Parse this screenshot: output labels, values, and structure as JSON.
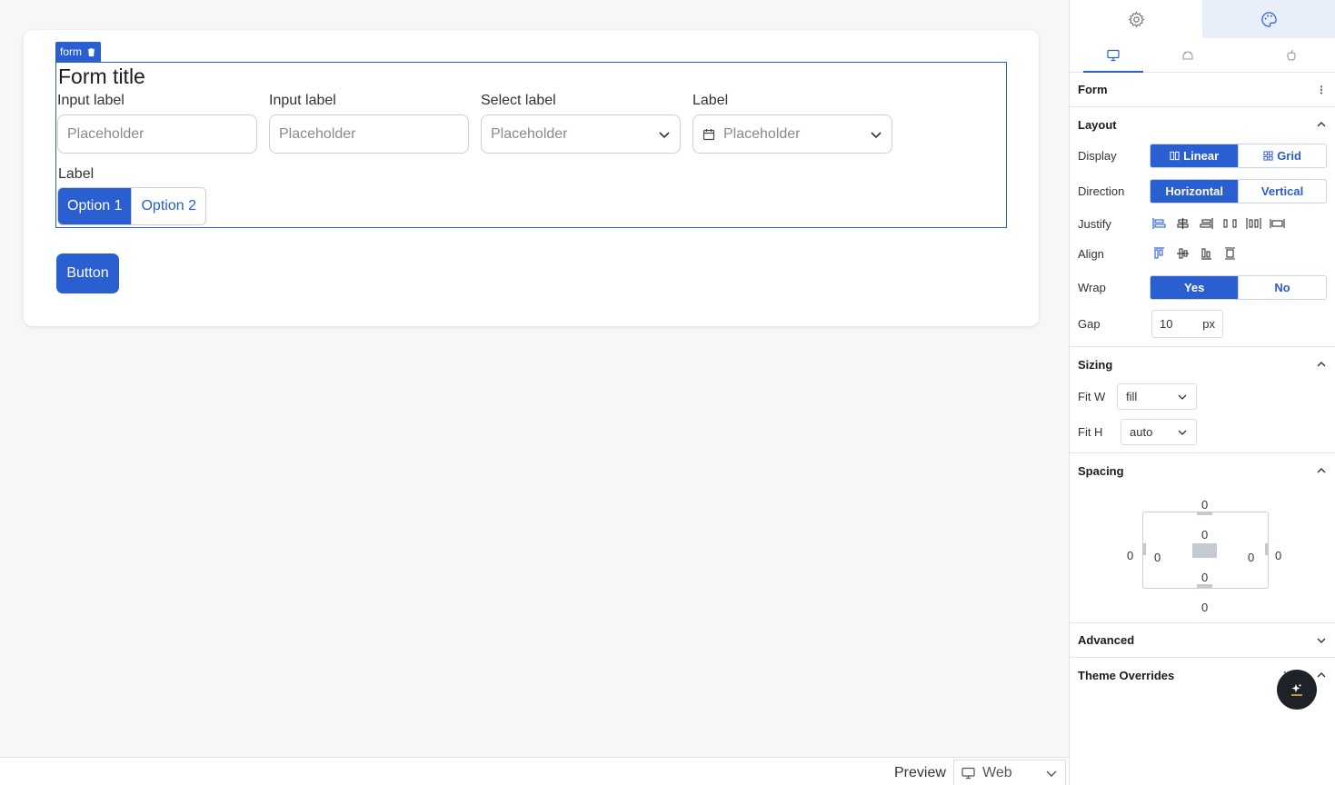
{
  "canvas": {
    "form_tag": "form",
    "form_title": "Form title",
    "fields": [
      {
        "label": "Input label",
        "placeholder": "Placeholder"
      },
      {
        "label": "Input label",
        "placeholder": "Placeholder"
      },
      {
        "label": "Select label",
        "placeholder": "Placeholder"
      },
      {
        "label": "Label",
        "placeholder": "Placeholder"
      }
    ],
    "segment": {
      "label": "Label",
      "options": [
        "Option 1",
        "Option 2"
      ],
      "selected": "Option 1"
    },
    "button_label": "Button"
  },
  "bottombar": {
    "preview_label": "Preview",
    "device": "Web"
  },
  "sidebar": {
    "component_title": "Form",
    "layout": {
      "title": "Layout",
      "display_label": "Display",
      "display_options": [
        "Linear",
        "Grid"
      ],
      "display_selected": "Linear",
      "direction_label": "Direction",
      "direction_options": [
        "Horizontal",
        "Vertical"
      ],
      "direction_selected": "Horizontal",
      "justify_label": "Justify",
      "align_label": "Align",
      "wrap_label": "Wrap",
      "wrap_options": [
        "Yes",
        "No"
      ],
      "wrap_selected": "Yes",
      "gap_label": "Gap",
      "gap_value": "10",
      "gap_unit": "px"
    },
    "sizing": {
      "title": "Sizing",
      "fit_w_label": "Fit W",
      "fit_w_value": "fill",
      "fit_h_label": "Fit H",
      "fit_h_value": "auto"
    },
    "spacing": {
      "title": "Spacing",
      "margin_top": "0",
      "margin_right": "0",
      "margin_bottom": "0",
      "margin_left": "0",
      "padding_top": "0",
      "padding_right": "0",
      "padding_bottom": "0",
      "padding_left": "0"
    },
    "advanced_title": "Advanced",
    "theme_overrides_title": "Theme Overrides"
  },
  "colors": {
    "accent": "#2a5fd1",
    "fab_bg": "#1f2329"
  }
}
